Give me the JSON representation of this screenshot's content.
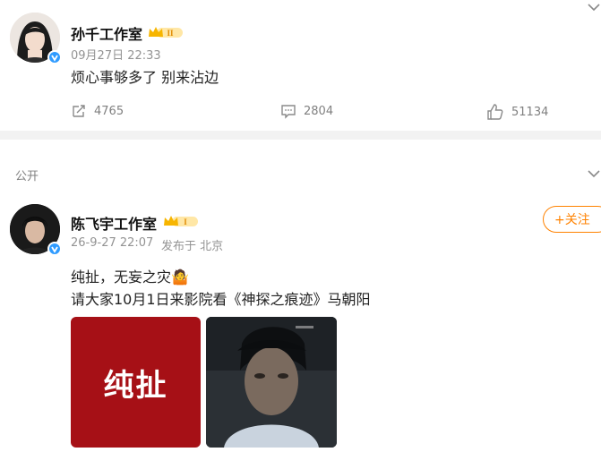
{
  "post1": {
    "author": "孙千工作室",
    "time": "09月27日 22:33",
    "text": "烦心事够多了 别来沾边",
    "reposts": "4765",
    "comments": "2804",
    "likes": "51134"
  },
  "section": {
    "label": "公开"
  },
  "post2": {
    "author": "陈飞宇工作室",
    "time": "26-9-27 22:07",
    "source": "发布于 北京",
    "follow_label": "+关注",
    "line1": "纯扯，无妄之灾🤷",
    "line2": "请大家10月1日来影院看《神探之痕迹》马朝阳",
    "image1_text": "纯扯"
  },
  "colors": {
    "accent": "#ff8200",
    "verified": "#2f9bff",
    "crown": "#f7b500"
  }
}
